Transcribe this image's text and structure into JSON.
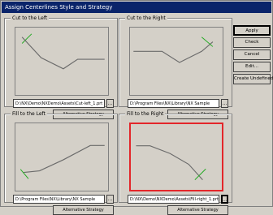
{
  "window": {
    "title": "Assign Centerlines Style and Strategy"
  },
  "panels": [
    {
      "id": "cut-to-left",
      "label": "Cut to the Left",
      "path": "D:\\NX\\Demo\\NXDemo\\Assets\\Cut-left_1.prt",
      "browse_label": "...",
      "alt_label": "Alternative Strategy",
      "active": false,
      "line_color": "#6b6b6b",
      "marker_color": "#22aa22"
    },
    {
      "id": "cut-to-right",
      "label": "Cut to the Right",
      "path": "D:\\Program Files\\NX\\Library\\NX Sample",
      "browse_label": "...",
      "alt_label": "Alternative Strategy",
      "active": false,
      "line_color": "#6b6b6b",
      "marker_color": "#22aa22"
    },
    {
      "id": "fill-to-left",
      "label": "Fill to the Left",
      "path": "D:\\Program Files\\NX\\Library\\NX Sample",
      "browse_label": "...",
      "alt_label": "Alternative Strategy",
      "active": false,
      "line_color": "#6b6b6b",
      "marker_color": "#22aa22"
    },
    {
      "id": "fill-to-right",
      "label": "Fill to the Right",
      "path": "D:\\NX\\Demo\\NXDemo\\Assets\\Fill-right_1.prt",
      "browse_label": "...",
      "alt_label": "Alternative Strategy",
      "active": true,
      "line_color": "#6b6b6b",
      "marker_color": "#22aa22"
    }
  ],
  "buttons": {
    "ok": "Apply",
    "check": "Check",
    "cancel": "Cancel",
    "edit": "Edit...",
    "create": "Create Undefined"
  },
  "colors": {
    "active_border": "#e3262a",
    "titlebar": "#0a246a"
  }
}
